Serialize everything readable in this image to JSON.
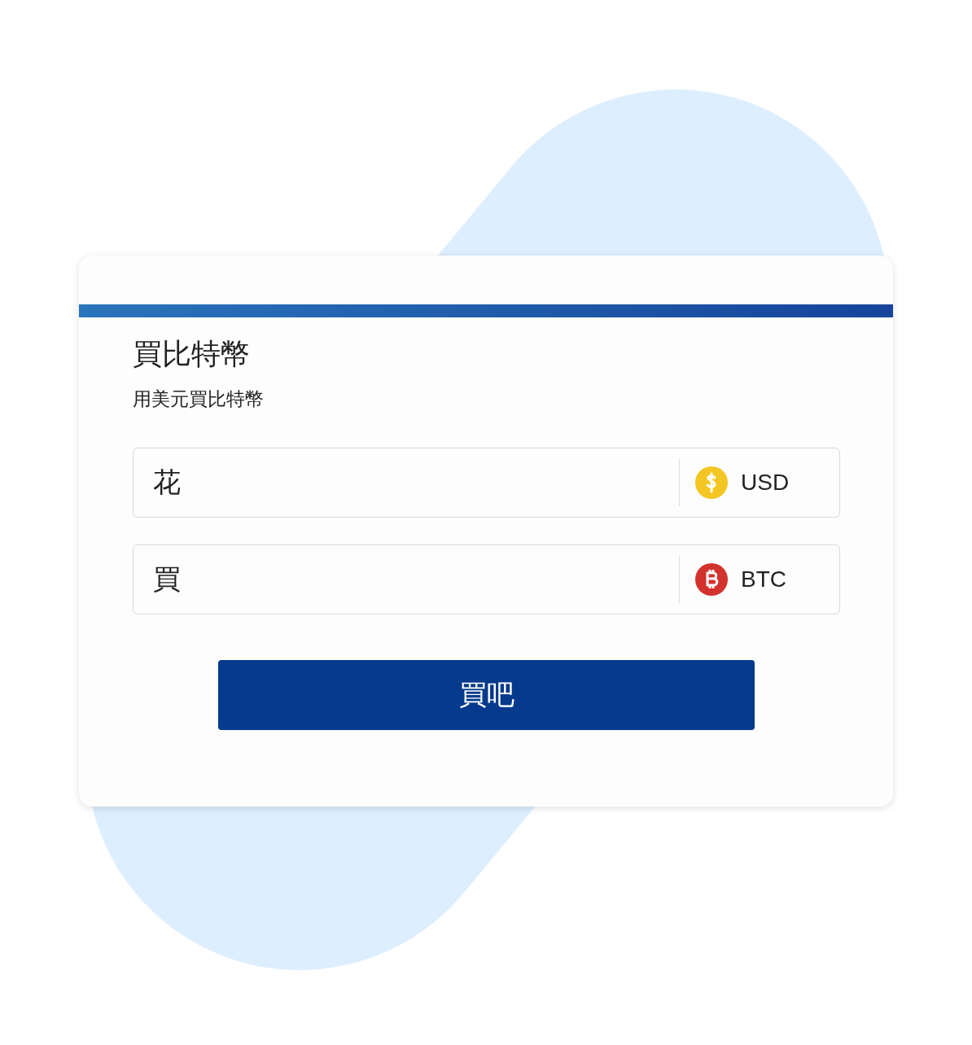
{
  "card": {
    "title": "買比特幣",
    "subtitle": "用美元買比特幣"
  },
  "fields": [
    {
      "label": "花",
      "currency": "USD",
      "kind": "dollar"
    },
    {
      "label": "買",
      "currency": "BTC",
      "kind": "bitcoin"
    }
  ],
  "button": {
    "label": "買吧"
  }
}
